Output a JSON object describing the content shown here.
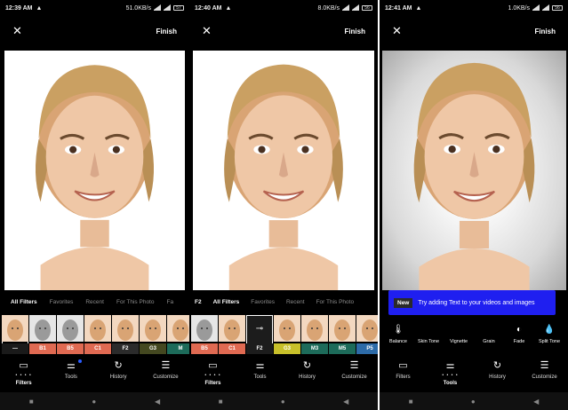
{
  "colors": {
    "accent_blue": "#1f1ff0",
    "badge_blue": "#2a5cff",
    "background": "#000000"
  },
  "screens": [
    {
      "status": {
        "time": "12:39 AM",
        "warn": "▲",
        "speed": "51.0KB/s",
        "battery": "57"
      },
      "topbar": {
        "close_icon": "✕",
        "finish": "Finish"
      },
      "tabs": [
        "All Filters",
        "Favorites",
        "Recent",
        "For This Photo",
        "Fa"
      ],
      "filters": [
        {
          "label": "—",
          "color": "#1a1a1a",
          "icon": "original"
        },
        {
          "label": "B1",
          "color": "#e06a52",
          "icon": "bw"
        },
        {
          "label": "B5",
          "color": "#e06a52",
          "icon": "bw"
        },
        {
          "label": "C1",
          "color": "#e06a52",
          "icon": "color"
        },
        {
          "label": "F2",
          "color": "#2b2b2b",
          "icon": "color"
        },
        {
          "label": "G3",
          "color": "#444820",
          "icon": "color"
        },
        {
          "label": "M",
          "color": "#1d6b5a",
          "icon": "color"
        }
      ],
      "nav": [
        {
          "label": "Filters",
          "icon": "▭",
          "dots": "• • • •"
        },
        {
          "label": "Tools",
          "icon": "⚌"
        },
        {
          "label": "History",
          "icon": "↻"
        },
        {
          "label": "Customize",
          "icon": "☰"
        }
      ]
    },
    {
      "status": {
        "time": "12:40 AM",
        "warn": "▲",
        "speed": "8.0KB/s",
        "battery": "56"
      },
      "topbar": {
        "close_icon": "✕",
        "finish": "Finish"
      },
      "tabs_lead": "F2",
      "tabs": [
        "All Filters",
        "Favorites",
        "Recent",
        "For This Photo"
      ],
      "filters": [
        {
          "label": "B5",
          "color": "#e06a52",
          "icon": "bw"
        },
        {
          "label": "C1",
          "color": "#e06a52",
          "icon": "color"
        },
        {
          "label": "F2",
          "color": "#1c1c1c",
          "icon": "adjust"
        },
        {
          "label": "G3",
          "color": "#c8c02a",
          "icon": "color"
        },
        {
          "label": "M3",
          "color": "#1d6b5a",
          "icon": "color"
        },
        {
          "label": "M5",
          "color": "#1d6b5a",
          "icon": "color"
        },
        {
          "label": "P5",
          "color": "#2d6ba8",
          "icon": "color"
        }
      ],
      "nav": [
        {
          "label": "Filters",
          "icon": "▭",
          "dots": "• • • •"
        },
        {
          "label": "Tools",
          "icon": "⚌"
        },
        {
          "label": "History",
          "icon": "↻"
        },
        {
          "label": "Customize",
          "icon": "☰"
        }
      ]
    },
    {
      "status": {
        "time": "12:41 AM",
        "warn": "▲",
        "speed": "1.0KB/s",
        "battery": "56"
      },
      "topbar": {
        "close_icon": "✕",
        "finish": "Finish"
      },
      "banner": {
        "badge": "New",
        "text": "Try adding Text to your videos and images"
      },
      "tools": [
        {
          "label": "Balance",
          "icon": "🌡"
        },
        {
          "label": "Skin Tone",
          "icon": ""
        },
        {
          "label": "Vignette",
          "icon": ""
        },
        {
          "label": "Grain",
          "icon": ""
        },
        {
          "label": "Fade",
          "icon": "◐"
        },
        {
          "label": "Split Tone",
          "icon": "💧"
        }
      ],
      "nav": [
        {
          "label": "Filters",
          "icon": "▭"
        },
        {
          "label": "Tools",
          "icon": "⚌",
          "dots": "• • • •"
        },
        {
          "label": "History",
          "icon": "↻"
        },
        {
          "label": "Customize",
          "icon": "☰"
        }
      ]
    }
  ],
  "sysnav": {
    "stop": "■",
    "home": "●",
    "back": "◀"
  }
}
